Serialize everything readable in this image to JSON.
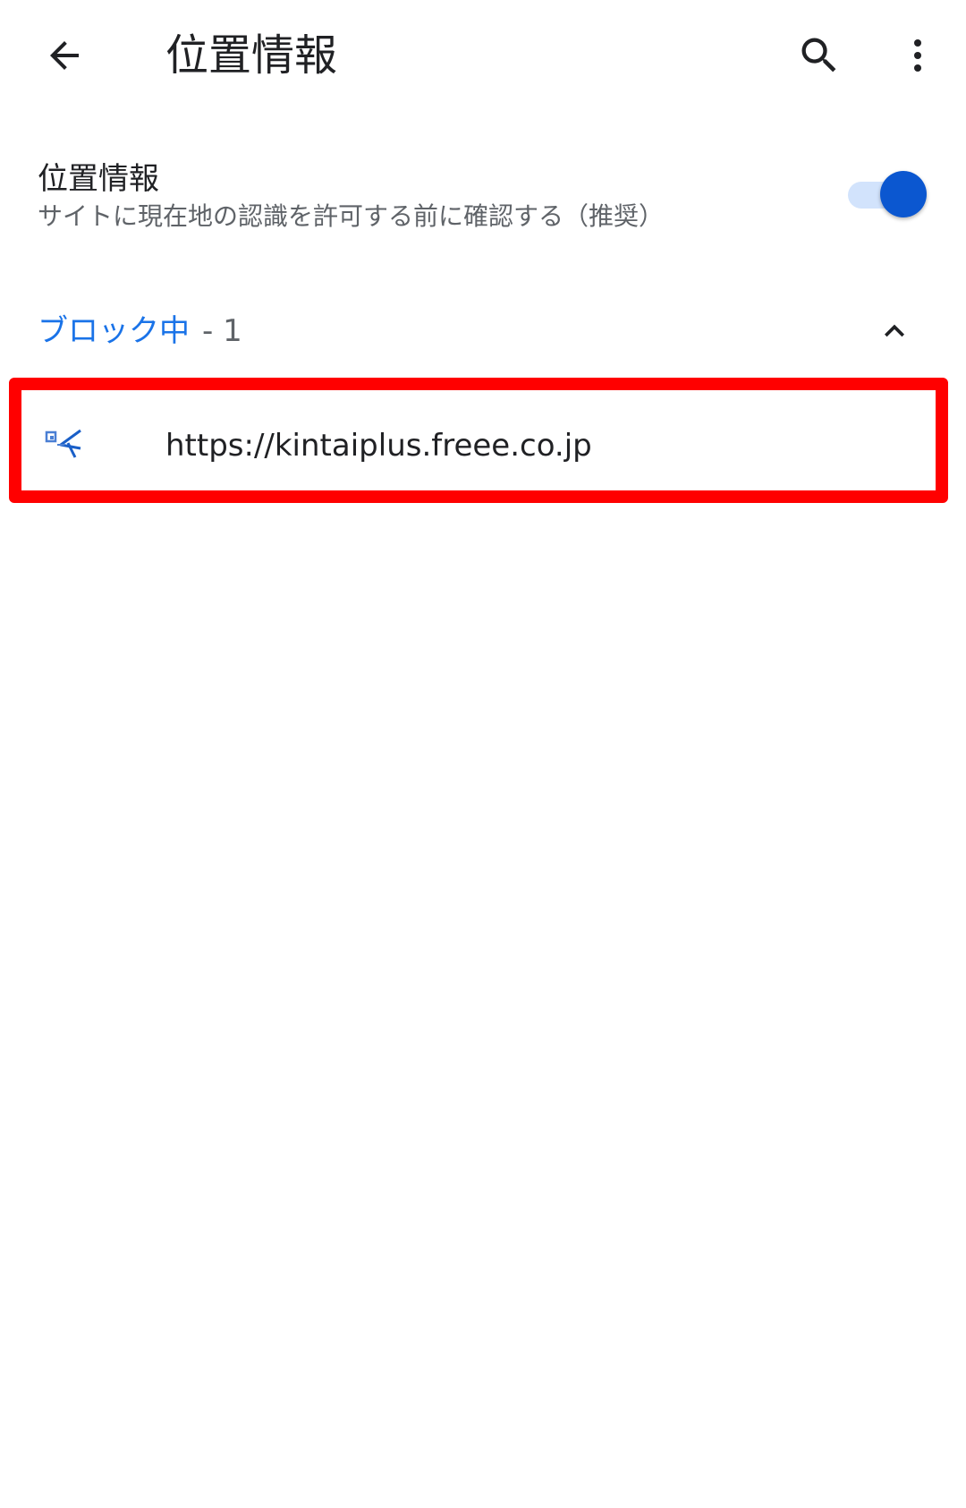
{
  "app_bar": {
    "title": "位置情報",
    "back_icon": "arrow-back-icon",
    "search_icon": "search-icon",
    "more_icon": "more-vert-icon"
  },
  "setting": {
    "title": "位置情報",
    "summary": "サイトに現在地の認識を許可する前に確認する（推奨）",
    "toggle_on": true,
    "accent_color": "#0b57d0"
  },
  "blocked_section": {
    "label": "ブロック中",
    "count": "- 1",
    "expanded": true,
    "label_color": "#1a73e8"
  },
  "sites": [
    {
      "url": "https://kintaiplus.freee.co.jp",
      "favicon": "site-favicon-icon"
    }
  ],
  "annotation": {
    "highlight_color": "#ff0000"
  }
}
